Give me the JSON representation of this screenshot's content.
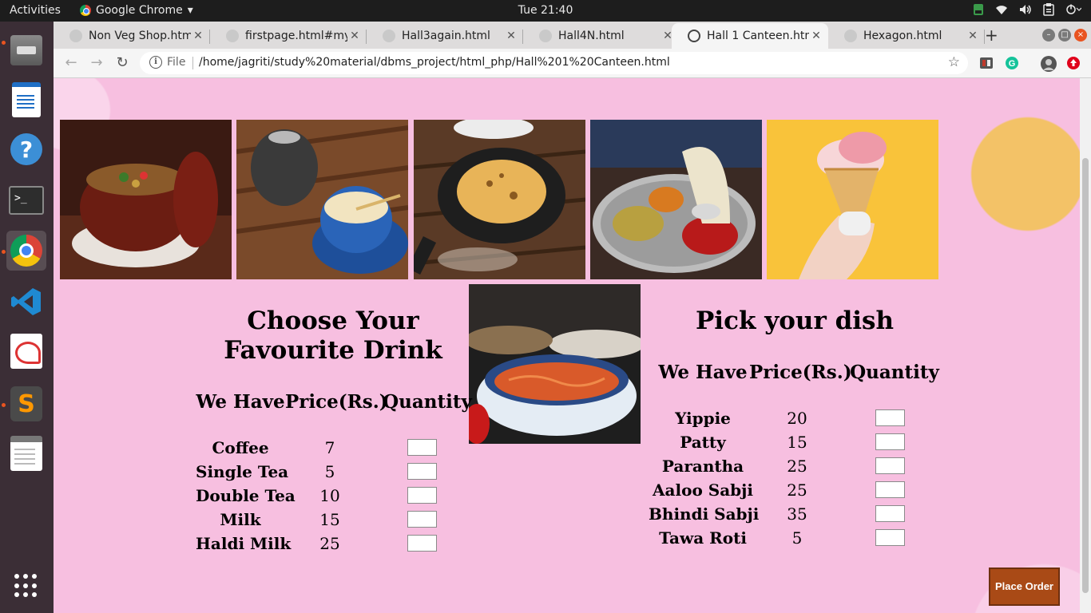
{
  "topbar": {
    "activities": "Activities",
    "app_name": "Google Chrome",
    "app_menu_arrow": "▾",
    "clock": "Tue 21:40",
    "tray": [
      "wifi-icon",
      "volume-icon",
      "clipboard-icon",
      "power-icon"
    ]
  },
  "dock": {
    "items": [
      "files-icon",
      "writer-icon",
      "help-icon",
      "terminal-icon",
      "chrome-icon",
      "vscode-icon",
      "document-viewer-icon",
      "sublime-text-icon",
      "text-editor-icon",
      "show-apps-icon"
    ],
    "terminal_glyph": ">_",
    "sublime_glyph": "S"
  },
  "browser": {
    "tabs": [
      {
        "label": "Non Veg Shop.htm",
        "active": false
      },
      {
        "label": "firstpage.html#my",
        "active": false
      },
      {
        "label": "Hall3again.html",
        "active": false
      },
      {
        "label": "Hall4N.html",
        "active": false
      },
      {
        "label": "Hall 1 Canteen.htm",
        "active": true
      },
      {
        "label": "Hexagon.html",
        "active": false
      }
    ],
    "close_glyph": "✕",
    "new_tab_glyph": "+",
    "nav": {
      "back": "←",
      "forward": "→",
      "reload": "↻"
    },
    "address": {
      "info_glyph": "i",
      "scheme": "File",
      "url": "/home/jagriti/study%20material/dbms_project/html_php/Hall%201%20Canteen.html",
      "star": "☆"
    },
    "extension_colors": [
      "#c0392b",
      "#15c39a",
      "#555555",
      "#e0001b"
    ]
  },
  "page": {
    "photos": [
      "curry-pot-photo",
      "tea-cup-photo",
      "paratha-pan-photo",
      "thali-plate-photo",
      "ice-cream-photo",
      "noodles-bowl-photo"
    ],
    "drinks": {
      "title": "Choose Your Favourite Drink",
      "headers": {
        "name": "We Have",
        "price": "Price(Rs.)",
        "qty": "Quantity"
      },
      "items": [
        {
          "name": "Coffee",
          "price": "7"
        },
        {
          "name": "Single Tea",
          "price": "5"
        },
        {
          "name": "Double Tea",
          "price": "10"
        },
        {
          "name": "Milk",
          "price": "15"
        },
        {
          "name": "Haldi Milk",
          "price": "25"
        }
      ]
    },
    "dishes": {
      "title": "Pick your dish",
      "headers": {
        "name": "We Have",
        "price": "Price(Rs.)",
        "qty": "Quantity"
      },
      "items": [
        {
          "name": "Yippie",
          "price": "20"
        },
        {
          "name": "Patty",
          "price": "15"
        },
        {
          "name": "Parantha",
          "price": "25"
        },
        {
          "name": "Aaloo Sabji",
          "price": "25"
        },
        {
          "name": "Bhindi Sabji",
          "price": "35"
        },
        {
          "name": "Tawa Roti",
          "price": "5"
        }
      ]
    },
    "place_order": "Place Order",
    "colors": {
      "background": "#f7bfe0",
      "button": "#a94a16"
    }
  }
}
